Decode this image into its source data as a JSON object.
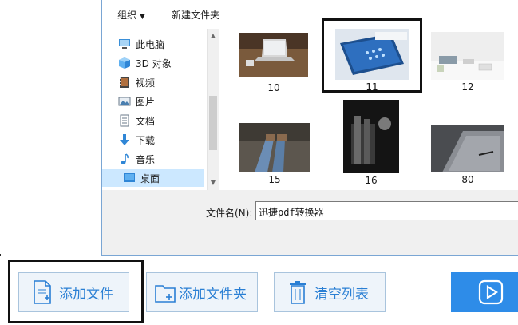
{
  "dialog": {
    "commands": {
      "organize": "组织",
      "new_folder": "新建文件夹"
    },
    "nav": [
      {
        "label": "此电脑",
        "icon": "computer-icon"
      },
      {
        "label": "3D 对象",
        "icon": "cube-3d-icon"
      },
      {
        "label": "视频",
        "icon": "video-icon"
      },
      {
        "label": "图片",
        "icon": "picture-icon"
      },
      {
        "label": "文档",
        "icon": "document-icon"
      },
      {
        "label": "下载",
        "icon": "download-arrow-icon"
      },
      {
        "label": "音乐",
        "icon": "music-note-icon"
      },
      {
        "label": "桌面",
        "icon": "desktop-icon",
        "selected": true
      }
    ],
    "files": [
      {
        "name": "10"
      },
      {
        "name": "11",
        "highlighted": true
      },
      {
        "name": "12"
      },
      {
        "name": "15"
      },
      {
        "name": "16"
      },
      {
        "name": "80"
      }
    ],
    "filename_label": "文件名(N):",
    "filename_value": "迅捷pdf转换器"
  },
  "toolbar": {
    "add_file": "添加文件",
    "add_folder": "添加文件夹",
    "clear_list": "清空列表"
  },
  "colors": {
    "accent": "#2e8ce8",
    "button_text": "#2a7fd4",
    "selection": "#cce8ff"
  }
}
